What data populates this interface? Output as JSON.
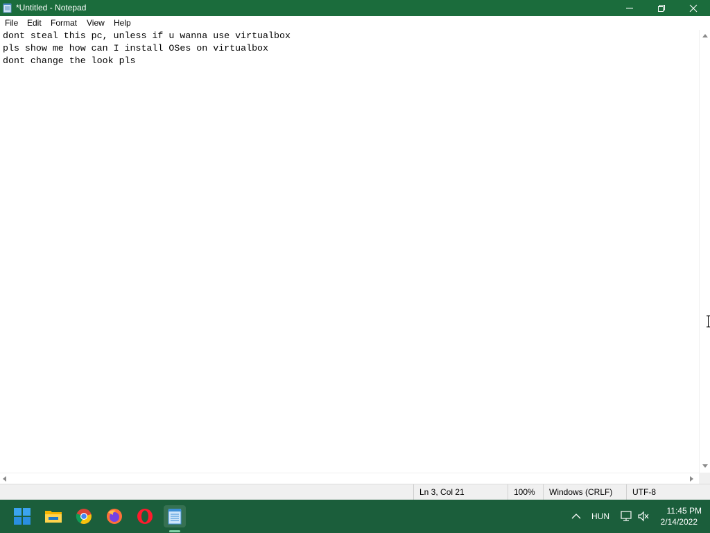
{
  "window": {
    "title": "*Untitled - Notepad",
    "accent_color": "#1b6c3c"
  },
  "menu": {
    "file": "File",
    "edit": "Edit",
    "format": "Format",
    "view": "View",
    "help": "Help"
  },
  "editor": {
    "lines": [
      "dont steal this pc, unless if u wanna use virtualbox",
      "pls show me how can I install OSes on virtualbox",
      "dont change the look pls"
    ]
  },
  "status": {
    "position": "Ln 3, Col 21",
    "zoom": "100%",
    "line_ending": "Windows (CRLF)",
    "encoding": "UTF-8"
  },
  "taskbar": {
    "color": "#1b5e3b",
    "apps": [
      "start-icon",
      "file-explorer-icon",
      "chrome-icon",
      "firefox-icon",
      "opera-icon",
      "notepad-icon"
    ],
    "active_app": "notepad-icon"
  },
  "tray": {
    "language": "HUN",
    "time": "11:45 PM",
    "date": "2/14/2022"
  }
}
